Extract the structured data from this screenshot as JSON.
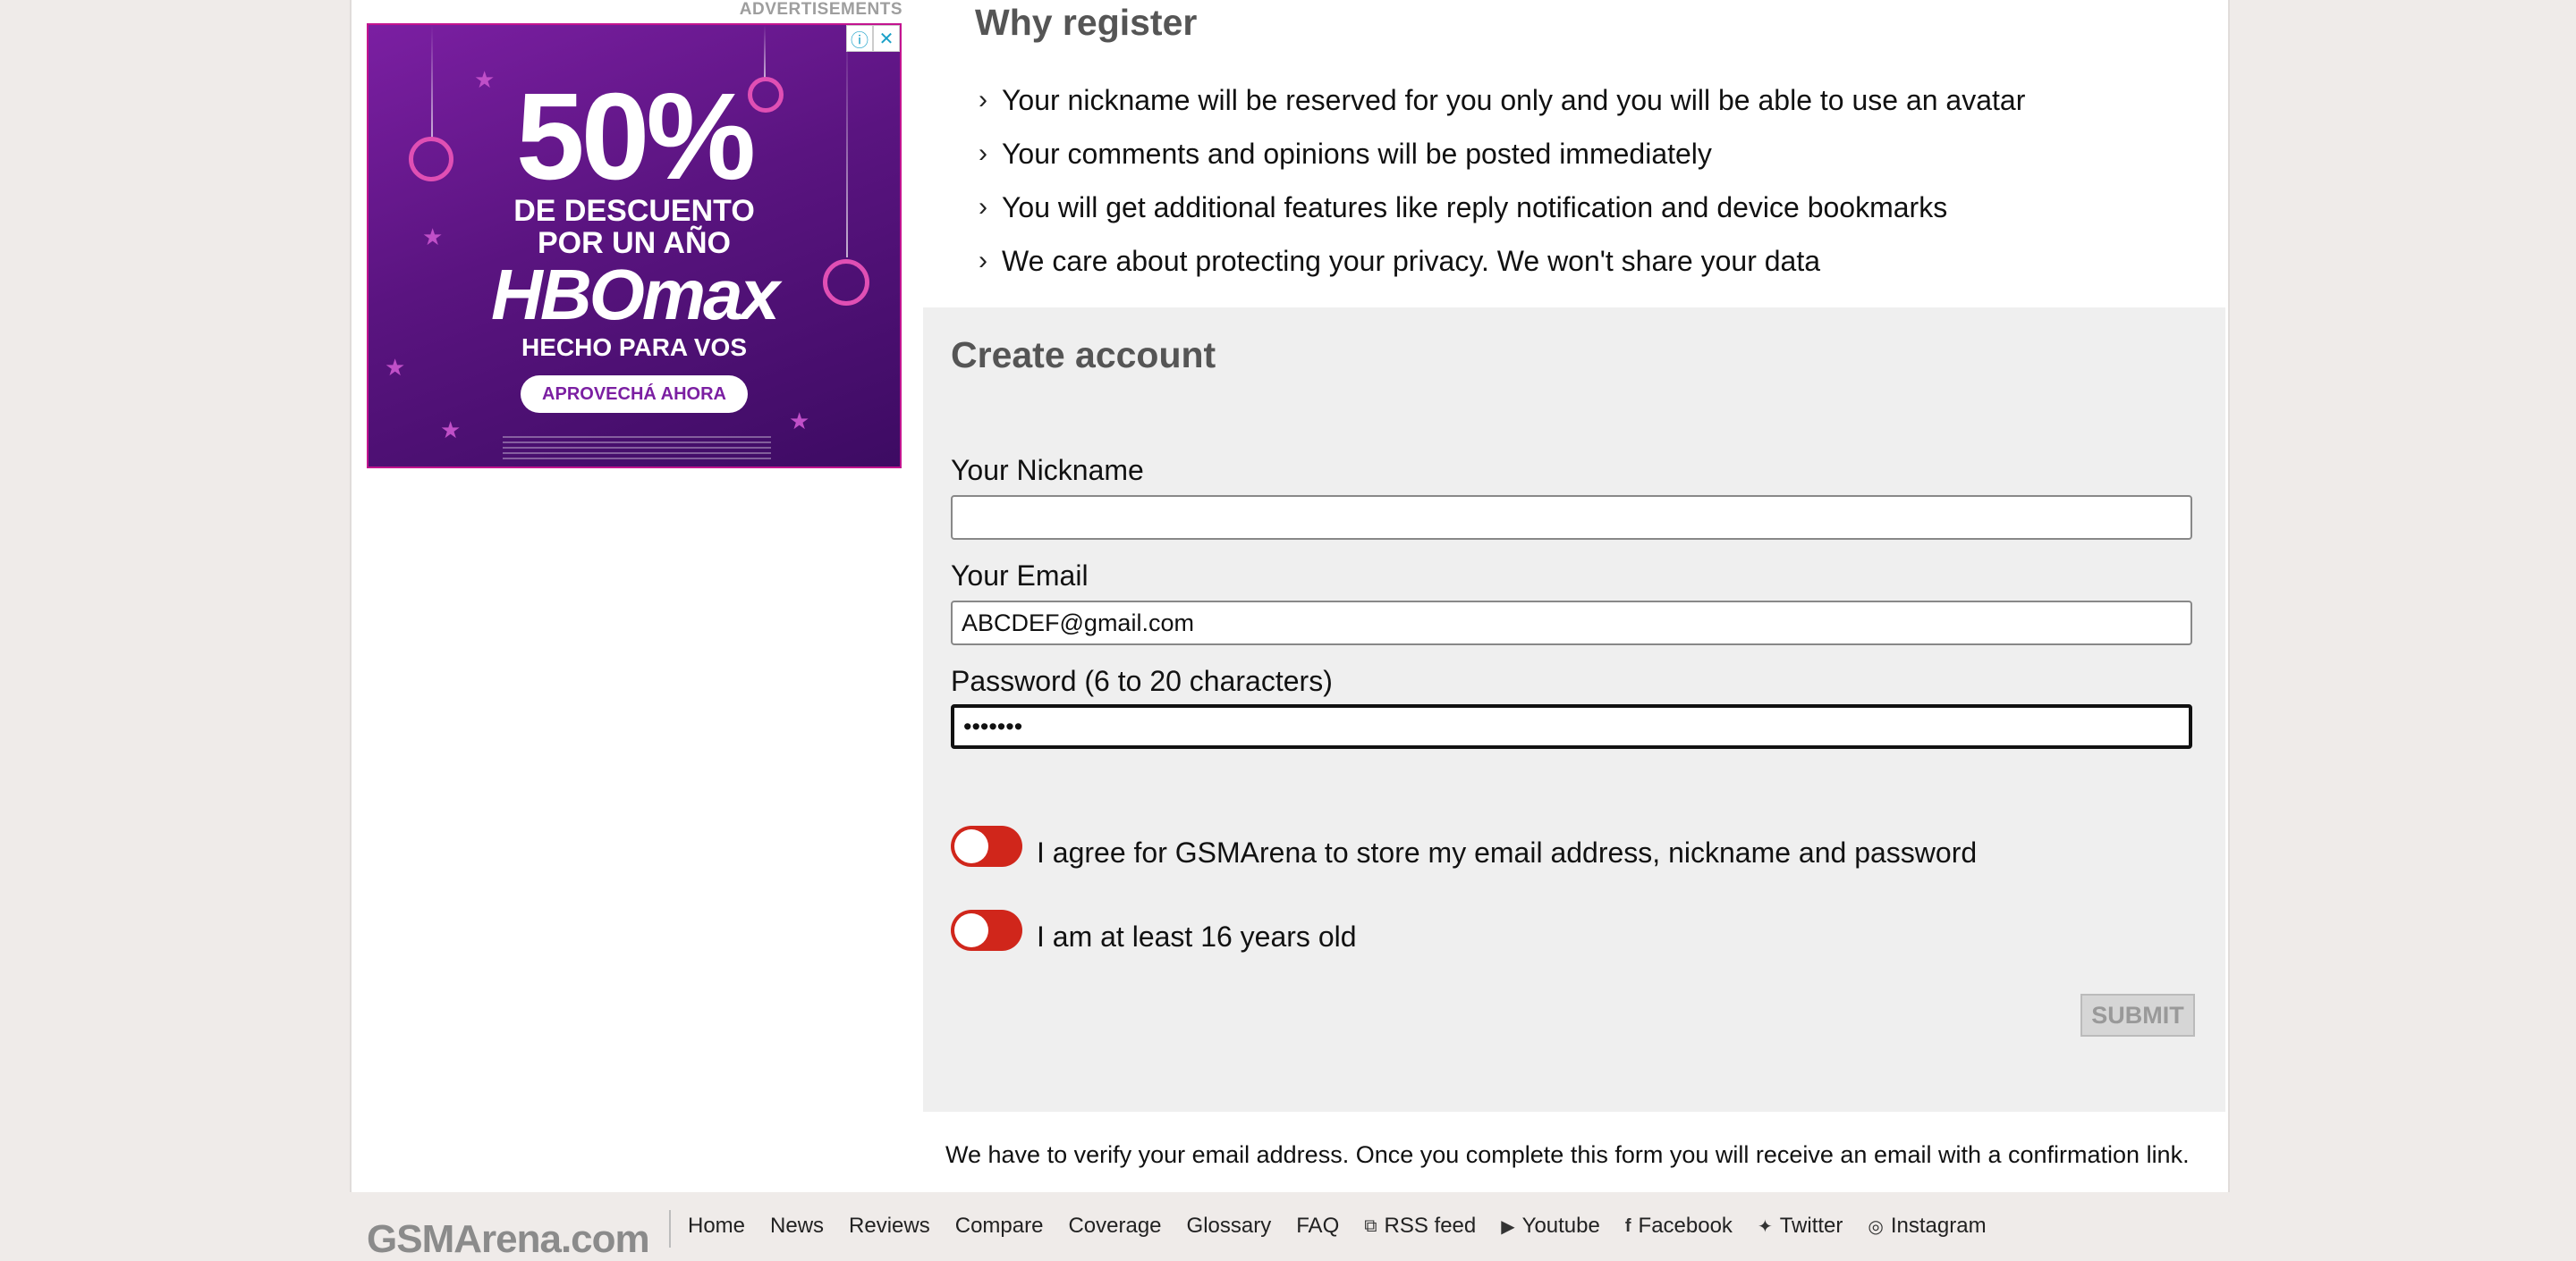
{
  "ad": {
    "label": "ADVERTISEMENTS",
    "percent": "50%",
    "line1": "DE DESCUENTO",
    "line2": "POR UN AÑO",
    "brand": "HBOmax",
    "tagline": "HECHO PARA VOS",
    "cta": "APROVECHÁ AHORA",
    "info_icon": "ⓘ",
    "close_icon": "✕"
  },
  "why": {
    "title": "Why register",
    "items": [
      "Your nickname will be reserved for you only and you will be able to use an avatar",
      "Your comments and opinions will be posted immediately",
      "You will get additional features like reply notification and device bookmarks",
      "We care about protecting your privacy. We won't share your data"
    ]
  },
  "form": {
    "title": "Create account",
    "nickname_label": "Your Nickname",
    "nickname_value": "",
    "email_label": "Your Email",
    "email_value": "ABCDEF@gmail.com",
    "password_label": "Password (6 to 20 characters)",
    "password_value": "•••••••",
    "agree_label": "I agree for GSMArena to store my email address, nickname and password",
    "age_label": "I am at least 16 years old",
    "submit_label": "SUBMIT",
    "toggle_color": "#d0261b"
  },
  "verify_note": "We have to verify your email address. Once you complete this form you will receive an email with a confirmation link.",
  "footer": {
    "logo": "GSMArena.com",
    "links": [
      {
        "label": "Home",
        "icon": ""
      },
      {
        "label": "News",
        "icon": ""
      },
      {
        "label": "Reviews",
        "icon": ""
      },
      {
        "label": "Compare",
        "icon": ""
      },
      {
        "label": "Coverage",
        "icon": ""
      },
      {
        "label": "Glossary",
        "icon": ""
      },
      {
        "label": "FAQ",
        "icon": ""
      },
      {
        "label": "RSS feed",
        "icon": "rss-icon"
      },
      {
        "label": "Youtube",
        "icon": "youtube-icon"
      },
      {
        "label": "Facebook",
        "icon": "facebook-icon"
      },
      {
        "label": "Twitter",
        "icon": "twitter-icon"
      },
      {
        "label": "Instagram",
        "icon": "instagram-icon"
      }
    ]
  }
}
